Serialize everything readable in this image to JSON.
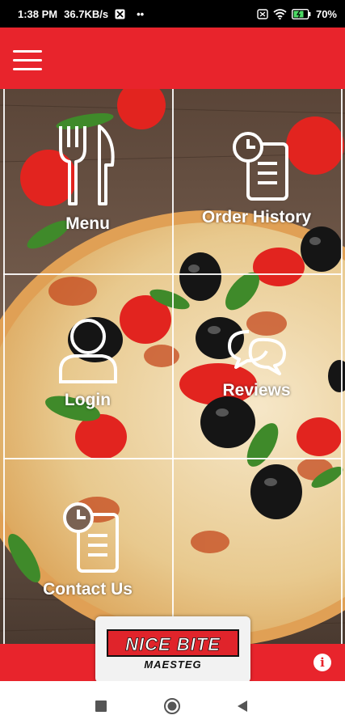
{
  "status_bar": {
    "time": "1:38 PM",
    "network_speed": "36.7KB/s",
    "dots": "••",
    "battery": "70%",
    "icons": [
      "app-icon",
      "sim-icon",
      "wifi-icon",
      "battery-icon"
    ]
  },
  "header": {
    "menu_icon": "hamburger-icon",
    "color": "#e8242c"
  },
  "tiles": [
    {
      "label": "Menu",
      "icon": "fork-knife-icon"
    },
    {
      "label": "Order History",
      "icon": "clock-document-icon"
    },
    {
      "label": "Login",
      "icon": "user-icon"
    },
    {
      "label": "Reviews",
      "icon": "chat-bubbles-icon"
    },
    {
      "label": "Contact Us",
      "icon": "clock-document-icon"
    }
  ],
  "footer": {
    "logo_title": "NICE BITE",
    "logo_subtitle": "MAESTEG",
    "info_icon": "info-icon",
    "info_glyph": "i"
  },
  "nav": {
    "buttons": [
      "recents-square-icon",
      "home-circle-icon",
      "back-triangle-icon"
    ]
  }
}
